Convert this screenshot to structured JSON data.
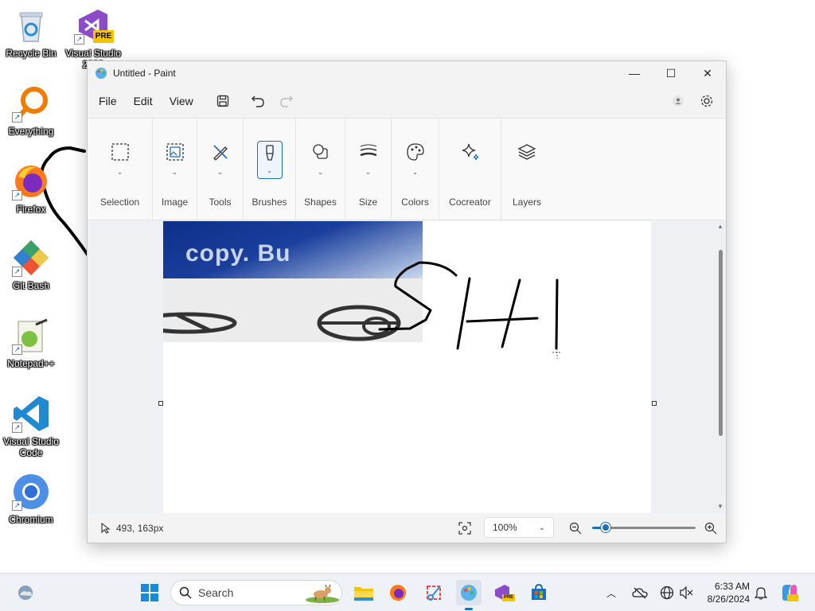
{
  "desktop": {
    "icons": [
      {
        "name": "recycle-bin",
        "label": "Recycle Bin"
      },
      {
        "name": "visual-studio-2022",
        "label": "Visual Studio 2022",
        "badge": "PRE"
      },
      {
        "name": "everything",
        "label": "Everything"
      },
      {
        "name": "firefox",
        "label": "Firefox"
      },
      {
        "name": "git-bash",
        "label": "Git Bash"
      },
      {
        "name": "notepad-plus-plus",
        "label": "Notepad++"
      },
      {
        "name": "visual-studio-code",
        "label": "Visual Studio Code"
      },
      {
        "name": "chromium",
        "label": "Chromium"
      }
    ]
  },
  "window": {
    "title": "Untitled - Paint",
    "controls": {
      "minimize": "—",
      "maximize": "☐",
      "close": "✕"
    }
  },
  "menu": {
    "file": "File",
    "edit": "Edit",
    "view": "View"
  },
  "ribbon": {
    "groups": [
      {
        "label": "Selection",
        "icon": "selection-icon"
      },
      {
        "label": "Image",
        "icon": "image-icon"
      },
      {
        "label": "Tools",
        "icon": "tools-icon"
      },
      {
        "label": "Brushes",
        "icon": "brush-icon"
      },
      {
        "label": "Shapes",
        "icon": "shapes-icon"
      },
      {
        "label": "Size",
        "icon": "size-icon"
      },
      {
        "label": "Colors",
        "icon": "palette-icon"
      },
      {
        "label": "Cocreator",
        "icon": "sparkle-icon"
      },
      {
        "label": "Layers",
        "icon": "layers-icon"
      }
    ]
  },
  "canvas": {
    "pasted_text": "copy. Bu"
  },
  "status": {
    "coords": "493, 163px",
    "zoom_value": "100%",
    "zoom_level": 0.13
  },
  "taskbar": {
    "search_placeholder": "Search",
    "time": "6:33 AM",
    "date": "8/26/2024",
    "badge": "PRE"
  },
  "colors": {
    "accent": "#1f6fb6",
    "window_bg": "#f3f3f3",
    "taskbar_bg": "#eef1f6"
  }
}
